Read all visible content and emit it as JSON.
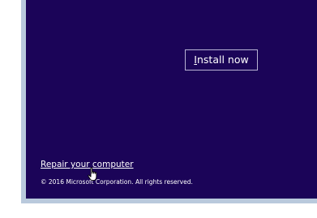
{
  "setup": {
    "install_button": {
      "mnemonic": "I",
      "rest": "nstall now"
    },
    "repair_link": "Repair your computer",
    "copyright": "© 2016 Microsoft Corporation. All rights reserved."
  },
  "colors": {
    "background": "#1b0458",
    "frame": "#b9c9dc",
    "text": "#ffffff"
  },
  "icons": {
    "cursor": "hand-pointer-icon"
  }
}
